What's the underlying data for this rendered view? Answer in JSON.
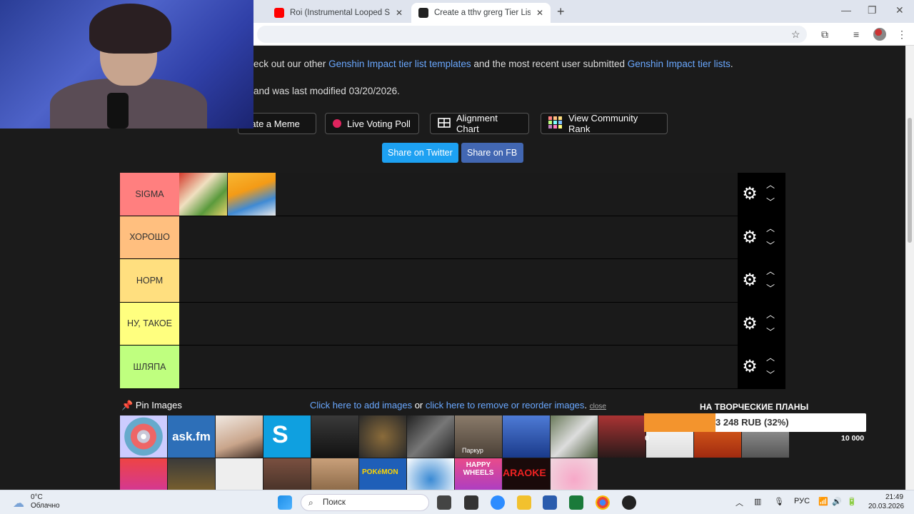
{
  "browser": {
    "tabs": [
      {
        "title": "Roi (Instrumental Looped Slowe",
        "favicon_color": "#ff0000"
      },
      {
        "title": "Create a tthv grerg Tier List - Ti",
        "favicon_color": "#222222"
      }
    ],
    "new_tab_icon": "+",
    "controls": {
      "minimize": "—",
      "restore": "❐",
      "close": "✕"
    },
    "toolbar_icons": [
      "star-icon",
      "extensions-icon",
      "media-icon",
      "profile-icon",
      "menu-icon"
    ]
  },
  "page": {
    "intro_prefix": "eck out our other ",
    "intro_link1": "Genshin Impact tier list templates",
    "intro_middle": " and the most recent user submitted ",
    "intro_link2": "Genshin Impact tier lists",
    "intro_suffix": ".",
    "modified_text": "and was last modified 03/20/2026.",
    "buttons": {
      "meme": "eate a Meme",
      "poll": "Live Voting Poll",
      "alignment": "Alignment Chart",
      "community": "View Community Rank"
    },
    "share": {
      "twitter": "Share on Twitter",
      "facebook": "Share on FB"
    },
    "tiers": [
      {
        "label": "SIGMA",
        "color": "#ff7f7f"
      },
      {
        "label": "ХОРОШО",
        "color": "#ffbf7f"
      },
      {
        "label": "НОРМ",
        "color": "#ffdf7f"
      },
      {
        "label": "НУ, ТАКОЕ",
        "color": "#ffff7f"
      },
      {
        "label": "ШЛЯПА",
        "color": "#bfff7f"
      }
    ],
    "pin_label": "Pin Images",
    "add_link": "Click here to add images",
    "or_text": " or ",
    "reorder_link": "click here to remove or reorder images",
    "close_link": "close",
    "thumb_captions": {
      "ask": "ask.fm",
      "cat": "Паркур",
      "pokemon": "POKéMON",
      "wheels": "HAPPY WHEELS",
      "karaoke": "ARAOKE"
    }
  },
  "donation": {
    "title": "НА ТВОРЧЕСКИЕ ПЛАНЫ",
    "amount": "3 248 RUB (32%)",
    "progress": 0.32,
    "min": "0",
    "max": "10 000"
  },
  "taskbar": {
    "temperature": "0°C",
    "weather": "Облачно",
    "search_placeholder": "Поиск",
    "language": "РУС",
    "time": "21:49",
    "date": "20.03.2026"
  }
}
